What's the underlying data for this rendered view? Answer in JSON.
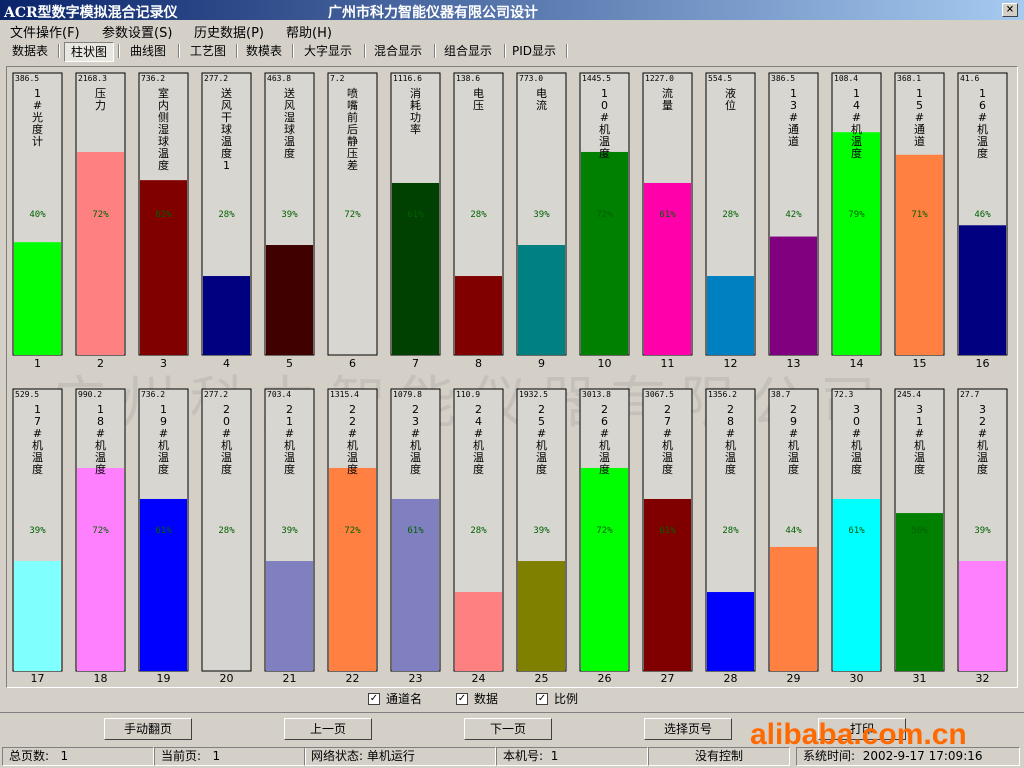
{
  "window": {
    "title": "ACR型数字模拟混合记录仪",
    "company": "广州市科力智能仪器有限公司设计",
    "close_glyph": "×"
  },
  "menu": [
    "文件操作(F)",
    "参数设置(S)",
    "历史数据(P)",
    "帮助(H)"
  ],
  "tabs": [
    "数据表",
    "柱状图",
    "曲线图",
    "工艺图",
    "数模表",
    "大字显示",
    "混合显示",
    "组合显示",
    "PID显示"
  ],
  "active_tab": "柱状图",
  "watermark": "广州科力智能仪器有限公司",
  "checkboxes": [
    {
      "label": "通道名",
      "checked": true
    },
    {
      "label": "数据",
      "checked": true
    },
    {
      "label": "比例",
      "checked": true
    }
  ],
  "check_glyph": "✓",
  "buttons": [
    "手动翻页",
    "上一页",
    "下一页",
    "选择页号",
    "打印"
  ],
  "brand_overlay": "alibaba.com.cn",
  "status": {
    "total_pages_label": "总页数:",
    "total_pages": "1",
    "current_page_label": "当前页:",
    "current_page": "1",
    "network_label": "网络状态:",
    "network": "单机运行",
    "device_label": "本机号:",
    "device": "1",
    "control": "没有控制",
    "time_label": "系统时间:",
    "time": "2002-9-17 17:09:16"
  },
  "chart_data": {
    "type": "bar",
    "categories": [
      "1",
      "2",
      "3",
      "4",
      "5",
      "6",
      "7",
      "8",
      "9",
      "10",
      "11",
      "12",
      "13",
      "14",
      "15",
      "16",
      "17",
      "18",
      "19",
      "20",
      "21",
      "22",
      "23",
      "24",
      "25",
      "26",
      "27",
      "28",
      "29",
      "30",
      "31",
      "32"
    ],
    "channel_names": [
      "1#光度计",
      "压力",
      "室内侧湿球温度",
      "送风干球温度1",
      "送风湿球温度",
      "喷嘴前后静压差",
      "消耗功率",
      "电压",
      "电流",
      "10#机温度",
      "流量",
      "液位",
      "13#通道",
      "14#机温度",
      "15#通道",
      "16#机温度",
      "17#机温度",
      "18#机温度",
      "19#机温度",
      "20#机温度",
      "21#机温度",
      "22#机温度",
      "23#机温度",
      "24#机温度",
      "25#机温度",
      "26#机温度",
      "27#机温度",
      "28#机温度",
      "29#机温度",
      "30#机温度",
      "31#机温度",
      "32#机温度"
    ],
    "values": [
      "386.5",
      "2168.3",
      "736.2",
      "277.2",
      "463.8",
      "7.2",
      "1116.6",
      "138.6",
      "773.0",
      "1445.5",
      "1227.0",
      "554.5",
      "386.5",
      "108.4",
      "368.1",
      "41.6",
      "529.5",
      "990.2",
      "736.2",
      "277.2",
      "703.4",
      "1315.4",
      "1079.8",
      "110.9",
      "1932.5",
      "3013.8",
      "3067.5",
      "1356.2",
      "38.7",
      "72.3",
      "245.4",
      "27.7"
    ],
    "percents": [
      40,
      72,
      62,
      28,
      39,
      72,
      61,
      28,
      39,
      72,
      61,
      28,
      42,
      79,
      71,
      46,
      39,
      72,
      61,
      28,
      39,
      72,
      61,
      28,
      39,
      72,
      61,
      28,
      44,
      61,
      56,
      39
    ],
    "fill_fraction": [
      0.4,
      0.72,
      0.62,
      0.28,
      0.39,
      0.0,
      0.61,
      0.28,
      0.39,
      0.72,
      0.61,
      0.28,
      0.42,
      0.79,
      0.71,
      0.46,
      0.39,
      0.72,
      0.61,
      0.0,
      0.39,
      0.72,
      0.61,
      0.28,
      0.39,
      0.72,
      0.61,
      0.28,
      0.44,
      0.61,
      0.56,
      0.39
    ],
    "colors": [
      "#00ff00",
      "#ff8080",
      "#800000",
      "#000080",
      "#400000",
      "#ffffff",
      "#004000",
      "#800000",
      "#008080",
      "#008000",
      "#ff00aa",
      "#0080c0",
      "#800080",
      "#00ff00",
      "#ff8040",
      "#000080",
      "#80ffff",
      "#ff80ff",
      "#0000ff",
      "#ffffff",
      "#8080c0",
      "#ff8040",
      "#8080c0",
      "#ff8080",
      "#808000",
      "#00ff00",
      "#800000",
      "#0000ff",
      "#ff8040",
      "#00ffff",
      "#008000",
      "#ff80ff"
    ],
    "ylim": [
      0,
      100
    ]
  }
}
